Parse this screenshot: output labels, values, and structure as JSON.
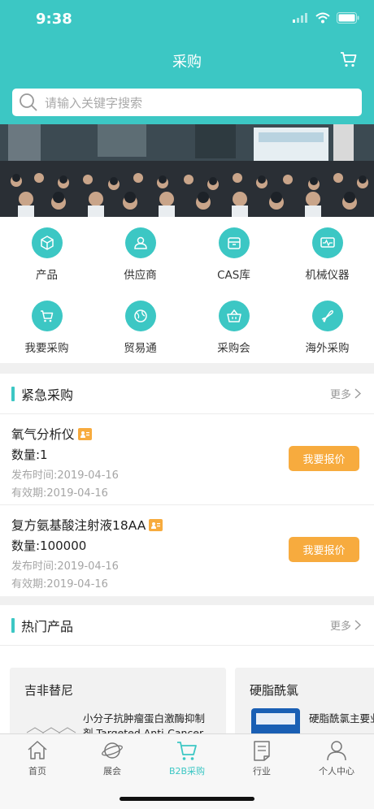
{
  "status_bar": {
    "time": "9:38"
  },
  "header": {
    "title": "采购"
  },
  "search": {
    "placeholder": "请输入关键字搜索"
  },
  "grid": [
    {
      "label": "产品",
      "icon": "box-icon"
    },
    {
      "label": "供应商",
      "icon": "user-card-icon"
    },
    {
      "label": "CAS库",
      "icon": "archive-icon"
    },
    {
      "label": "机械仪器",
      "icon": "monitor-icon"
    },
    {
      "label": "我要采购",
      "icon": "cart-icon"
    },
    {
      "label": "贸易通",
      "icon": "globe-icon"
    },
    {
      "label": "采购会",
      "icon": "basket-icon"
    },
    {
      "label": "海外采购",
      "icon": "plane-icon"
    }
  ],
  "urgent": {
    "title": "紧急采购",
    "more": "更多",
    "items": [
      {
        "name": "氧气分析仪",
        "qty": "数量:1",
        "published": "发布时间:2019-04-16",
        "expires": "有效期:2019-04-16",
        "button": "我要报价"
      },
      {
        "name": "复方氨基酸注射液18AA",
        "qty": "数量:100000",
        "published": "发布时间:2019-04-16",
        "expires": "有效期:2019-04-16",
        "button": "我要报价"
      }
    ]
  },
  "hot": {
    "title": "热门产品",
    "more": "更多",
    "cards": [
      {
        "name": "吉非替尼",
        "desc": "小分子抗肿瘤蛋白激酶抑制剂 Targeted Anti-Cancer"
      },
      {
        "name": "硬脂酰氯",
        "desc": "硬脂酰氯主要业.也用于有机"
      }
    ]
  },
  "tabs": [
    {
      "label": "首页",
      "icon": "home-icon"
    },
    {
      "label": "展会",
      "icon": "planet-icon"
    },
    {
      "label": "B2B采购",
      "icon": "cart-icon",
      "active": true
    },
    {
      "label": "行业",
      "icon": "document-icon"
    },
    {
      "label": "个人中心",
      "icon": "person-icon"
    }
  ],
  "colors": {
    "accent": "#3cc7c4",
    "button": "#f7ab3e"
  }
}
